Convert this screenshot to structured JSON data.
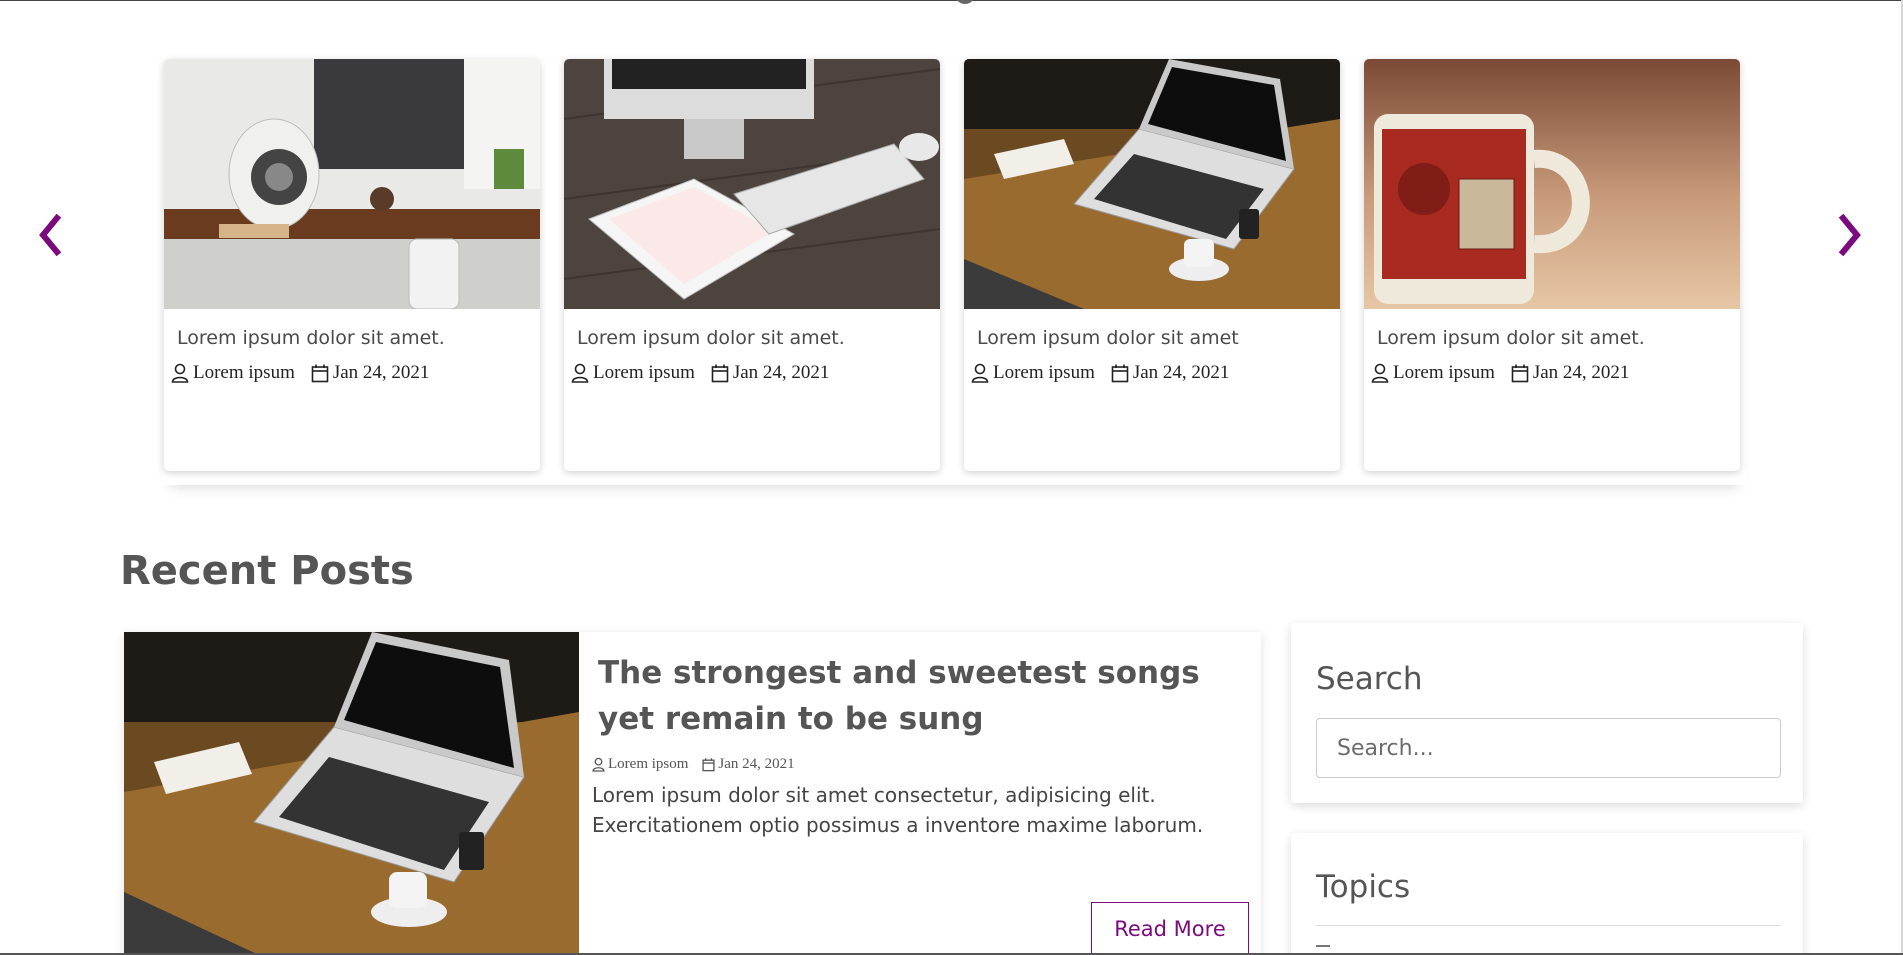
{
  "carousel": {
    "prev_icon": "chevron-left-icon",
    "next_icon": "chevron-right-icon",
    "accent": "#7a0a7e",
    "cards": [
      {
        "image": "desk-speaker-monitor-photo",
        "title": "Lorem ipsum dolor sit amet.",
        "author": "Lorem ipsum",
        "date": "Jan 24, 2021"
      },
      {
        "image": "imac-keyboard-tablet-photo",
        "title": "Lorem ipsum dolor sit amet.",
        "author": "Lorem ipsum",
        "date": "Jan 24, 2021"
      },
      {
        "image": "laptop-coffee-desk-photo",
        "title": "Lorem ipsum dolor sit amet",
        "author": "Lorem ipsum",
        "date": "Jan 24, 2021"
      },
      {
        "image": "vintage-stamp-mug-photo",
        "title": "Lorem ipsum dolor sit amet.",
        "author": "Lorem ipsum",
        "date": "Jan 24, 2021"
      }
    ]
  },
  "recent": {
    "heading": "Recent Posts",
    "post": {
      "image": "laptop-coffee-desk-photo",
      "title": "The strongest and sweetest songs yet remain to be sung",
      "author": "Lorem ipsom",
      "date": "Jan 24, 2021",
      "excerpt": "Lorem ipsum dolor sit amet consectetur, adipisicing elit. Exercitationem optio possimus a inventore maxime laborum.",
      "read_more": "Read More"
    }
  },
  "sidebar": {
    "search": {
      "heading": "Search",
      "placeholder": "Search..."
    },
    "topics": {
      "heading": "Topics"
    }
  }
}
